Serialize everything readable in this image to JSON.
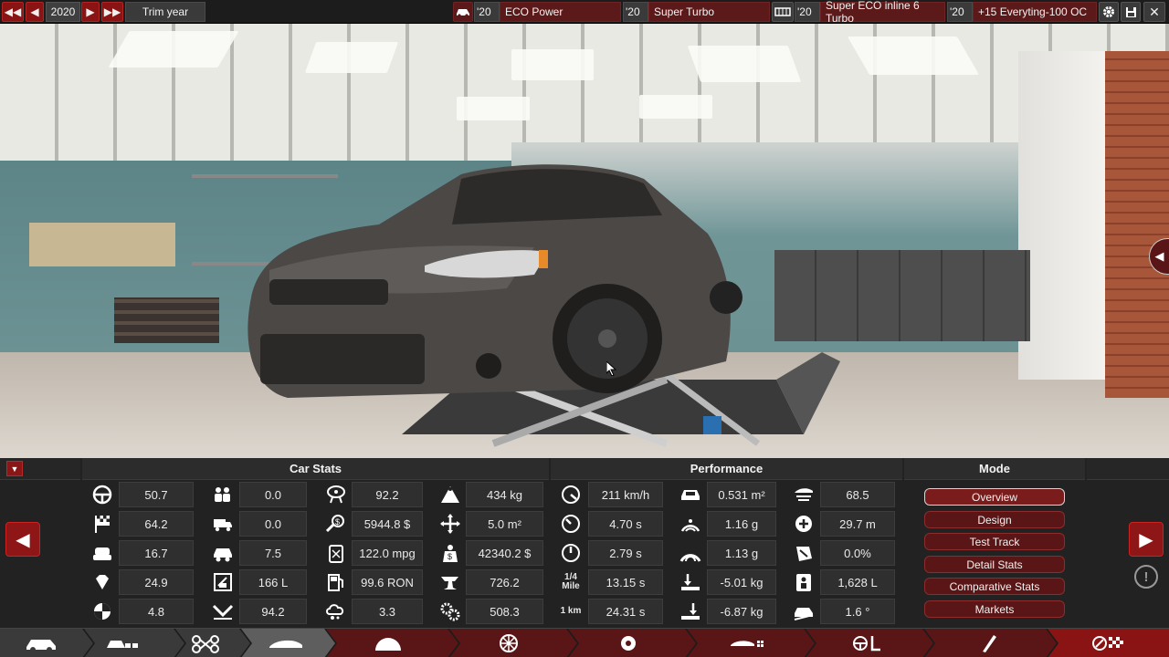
{
  "topbar": {
    "year": "2020",
    "trim_label": "Trim year",
    "model_year": "'20",
    "model_name": "ECO Power",
    "trim_year": "'20",
    "trim_name": "Super Turbo",
    "engine_year": "'20",
    "engine_name": "Super ECO inline 6 Turbo",
    "variant_year": "'20",
    "variant_name": "+15 Everyting-100 OC"
  },
  "panel": {
    "collapse_icon": "▼",
    "car_stats_title": "Car Stats",
    "performance_title": "Performance",
    "mode_title": "Mode",
    "car_stats": [
      {
        "icon": "steering-wheel-icon",
        "value": "50.7"
      },
      {
        "icon": "race-flag-icon",
        "value": "64.2"
      },
      {
        "icon": "seat-icon",
        "value": "16.7"
      },
      {
        "icon": "diamond-icon",
        "value": "24.9"
      },
      {
        "icon": "crash-test-icon",
        "value": "4.8"
      },
      {
        "icon": "passengers-icon",
        "value": "0.0"
      },
      {
        "icon": "cargo-truck-icon",
        "value": "0.0"
      },
      {
        "icon": "offroad-car-icon",
        "value": "7.5"
      },
      {
        "icon": "fuel-tank-icon",
        "value": "166 L"
      },
      {
        "icon": "efficiency-arrow-icon",
        "value": "94.2"
      },
      {
        "icon": "service-cost-icon",
        "value": "92.2"
      },
      {
        "icon": "cost-dollar-icon",
        "value": "5944.8 $"
      },
      {
        "icon": "fuel-can-icon",
        "value": "122.0 mpg"
      },
      {
        "icon": "fuel-pump-icon",
        "value": "99.6 RON"
      },
      {
        "icon": "emissions-cloud-icon",
        "value": "3.3"
      },
      {
        "icon": "weight-icon",
        "value": "434 kg"
      },
      {
        "icon": "area-arrows-icon",
        "value": "5.0 m²"
      },
      {
        "icon": "price-bag-icon",
        "value": "42340.2 $"
      },
      {
        "icon": "manufacturing-anvil-icon",
        "value": "726.2"
      },
      {
        "icon": "engineering-gears-icon",
        "value": "508.3"
      }
    ],
    "performance": [
      {
        "icon": "top-speed-gauge-icon",
        "value": "211 km/h"
      },
      {
        "icon": "accel-gauge-100-icon",
        "value": "4.70 s"
      },
      {
        "icon": "accel-gauge-60-icon",
        "value": "2.79 s"
      },
      {
        "icon": "quarter-mile-icon",
        "label": "1/4 Mile",
        "value": "13.15 s"
      },
      {
        "icon": "one-km-icon",
        "label": "1 km",
        "value": "24.31 s"
      },
      {
        "icon": "frontal-area-icon",
        "value": "0.531 m²"
      },
      {
        "icon": "cornering-icon",
        "value": "1.16 g"
      },
      {
        "icon": "cornering-high-icon",
        "value": "1.13 g"
      },
      {
        "icon": "downforce-front-icon",
        "value": "-5.01 kg"
      },
      {
        "icon": "downforce-rear-icon",
        "value": "-6.87 kg"
      },
      {
        "icon": "drag-car-icon",
        "value": "68.5"
      },
      {
        "icon": "turn-radius-icon",
        "value": "29.7 m"
      },
      {
        "icon": "brake-fade-icon",
        "value": "0.0%"
      },
      {
        "icon": "cargo-volume-icon",
        "value": "1,628 L"
      },
      {
        "icon": "ramp-angle-icon",
        "value": "1.6 °"
      }
    ],
    "modes": [
      {
        "label": "Overview",
        "active": true
      },
      {
        "label": "Design",
        "active": false
      },
      {
        "label": "Test Track",
        "active": false
      },
      {
        "label": "Detail Stats",
        "active": false
      },
      {
        "label": "Comparative Stats",
        "active": false
      },
      {
        "label": "Markets",
        "active": false
      }
    ]
  },
  "navbar": {
    "items": [
      "car-model-icon",
      "body-family-icon",
      "chassis-icon",
      "body-icon",
      "fixture-icon",
      "suspension-wheel-icon",
      "tires-icon",
      "aero-icon",
      "interior-icon",
      "test-icon",
      "final-stage-icon"
    ]
  },
  "colors": {
    "accent_red": "#8a1414",
    "panel_bg": "#222222",
    "value_box": "#2f2f2f"
  }
}
